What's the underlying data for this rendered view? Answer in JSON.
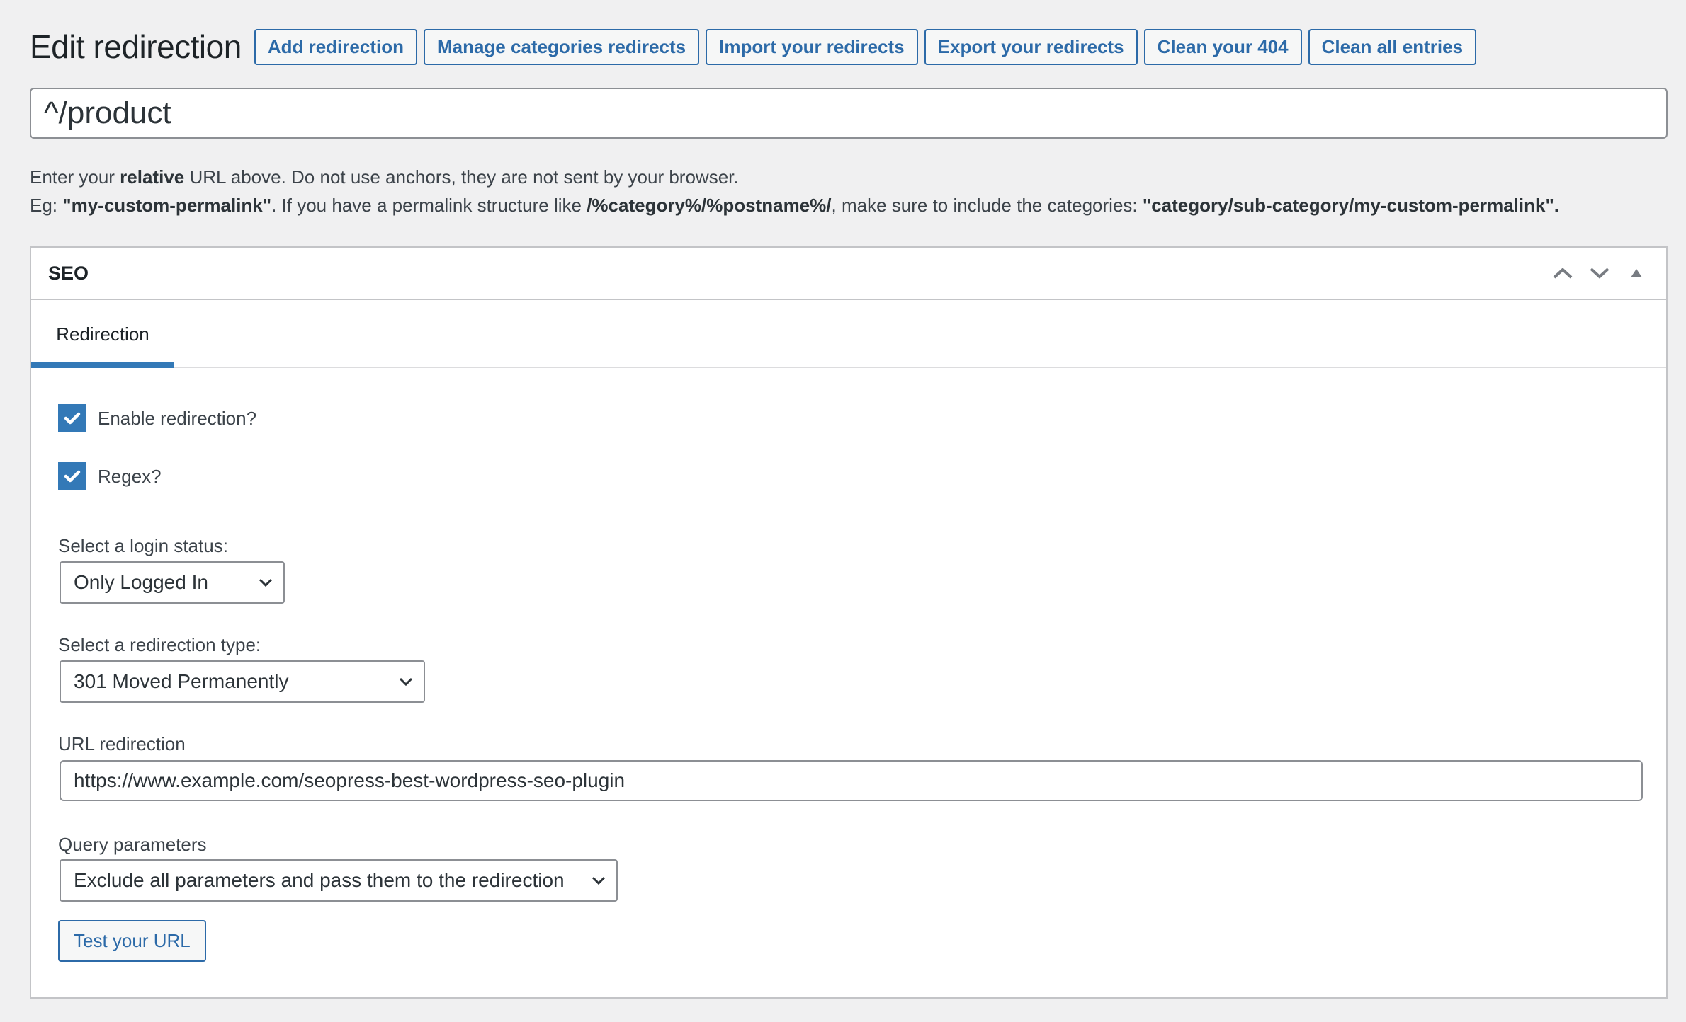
{
  "header": {
    "title": "Edit redirection",
    "buttons": [
      {
        "label": "Add redirection"
      },
      {
        "label": "Manage categories redirects"
      },
      {
        "label": "Import your redirects"
      },
      {
        "label": "Export your redirects"
      },
      {
        "label": "Clean your 404"
      },
      {
        "label": "Clean all entries"
      }
    ]
  },
  "source_url": {
    "value": "^/product"
  },
  "help": {
    "line1_prefix": "Enter your ",
    "line1_bold": "relative",
    "line1_suffix": " URL above. Do not use anchors, they are not sent by your browser.",
    "line2_prefix": "Eg: ",
    "line2_example": "\"my-custom-permalink\"",
    "line2_mid": ". If you have a permalink structure like ",
    "line2_structure": "/%category%/%postname%/",
    "line2_mid2": ", make sure to include the categories: ",
    "line2_example2": "\"category/sub-category/my-custom-permalink\"."
  },
  "metabox": {
    "title": "SEO",
    "controls": {
      "move_up": "move-up",
      "move_down": "move-down",
      "toggle": "toggle-panel"
    },
    "tabs": [
      {
        "label": "Redirection",
        "active": true
      }
    ],
    "fields": {
      "enable_redirection": {
        "label": "Enable redirection?",
        "checked": true
      },
      "regex": {
        "label": "Regex?",
        "checked": true
      },
      "login_status": {
        "label": "Select a login status:",
        "selected": "Only Logged In"
      },
      "redirection_type": {
        "label": "Select a redirection type:",
        "selected": "301 Moved Permanently"
      },
      "url_redirection": {
        "label": "URL redirection",
        "value": "https://www.example.com/seopress-best-wordpress-seo-plugin"
      },
      "query_parameters": {
        "label": "Query parameters",
        "selected": "Exclude all parameters and pass them to the redirection"
      },
      "test_button": {
        "label": "Test your URL"
      }
    }
  },
  "colors": {
    "accent": "#2c6aa8",
    "checkbox": "#3379b7",
    "background": "#f0f0f1",
    "border": "#c3c4c7"
  }
}
